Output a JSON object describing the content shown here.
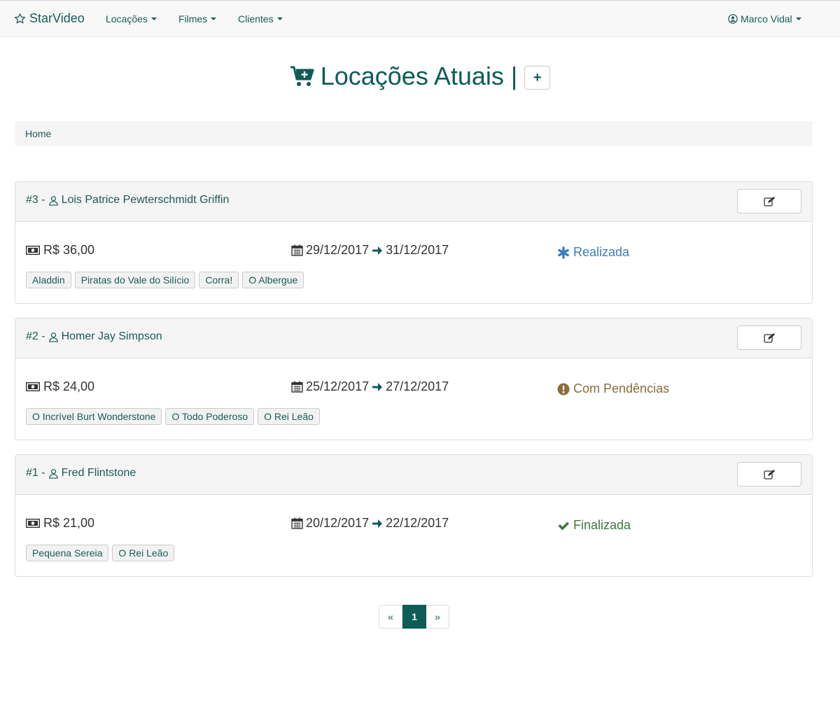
{
  "navbar": {
    "brand": "StarVideo",
    "menus": [
      {
        "label": "Locações"
      },
      {
        "label": "Filmes"
      },
      {
        "label": "Clientes"
      }
    ],
    "user": "Marco Vidal"
  },
  "header": {
    "title": "Locações Atuais",
    "separator": "|",
    "add_label": "+"
  },
  "breadcrumb": {
    "home": "Home"
  },
  "rentals": [
    {
      "title": "#3 -",
      "customer": "Lois Patrice Pewterschmidt Griffin",
      "price": "R$ 36,00",
      "start": "29/12/2017",
      "end": "31/12/2017",
      "status": "Realizada",
      "status_color": "#3b7dbf",
      "status_icon": "asterisk-icon",
      "movies": [
        "Aladdin",
        "Piratas do Vale do Silício",
        "Corra!",
        "O Albergue"
      ]
    },
    {
      "title": "#2 -",
      "customer": "Homer Jay Simpson",
      "price": "R$ 24,00",
      "start": "25/12/2017",
      "end": "27/12/2017",
      "status": "Com Pendências",
      "status_color": "#8a6d3b",
      "status_icon": "exclamation-circle-icon",
      "movies": [
        "O Incrível Burt Wonderstone",
        "O Todo Poderoso",
        "O Rei Leão"
      ]
    },
    {
      "title": "#1 -",
      "customer": "Fred Flintstone",
      "price": "R$ 21,00",
      "start": "20/12/2017",
      "end": "22/12/2017",
      "status": "Finalizada",
      "status_color": "#3c763d",
      "status_icon": "check-icon",
      "movies": [
        "Pequena Sereia",
        "O Rei Leão"
      ]
    }
  ],
  "pagination": {
    "prev": "«",
    "current": "1",
    "next": "»"
  },
  "colors": {
    "primary": "#0d5c57",
    "navbar_bg": "#f8f8f8"
  }
}
